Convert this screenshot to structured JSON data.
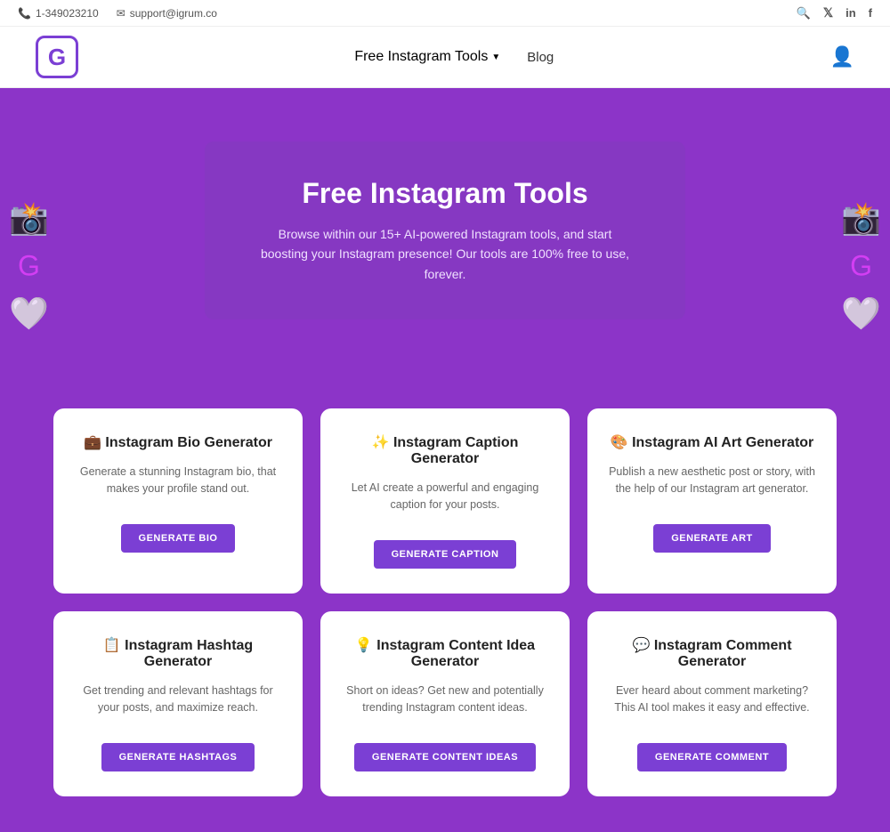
{
  "topbar": {
    "phone": "1-349023210",
    "email": "support@igrum.co"
  },
  "nav": {
    "logo_letter": "G",
    "tools_label": "Free Instagram Tools",
    "blog_label": "Blog"
  },
  "hero": {
    "title": "Free Instagram Tools",
    "description": "Browse within our 15+ AI-powered Instagram tools, and start boosting your Instagram presence! Our tools are 100% free to use, forever."
  },
  "cards": [
    {
      "emoji": "💼",
      "title": "Instagram Bio Generator",
      "description": "Generate a stunning Instagram bio, that makes your profile stand out.",
      "button": "GENERATE BIO"
    },
    {
      "emoji": "✨",
      "title": "Instagram Caption Generator",
      "description": "Let AI create a powerful and engaging caption for your posts.",
      "button": "GENERATE CAPTION"
    },
    {
      "emoji": "🎨",
      "title": "Instagram AI Art Generator",
      "description": "Publish a new aesthetic post or story, with the help of our Instagram art generator.",
      "button": "GENERATE ART"
    },
    {
      "emoji": "📋",
      "title": "Instagram Hashtag Generator",
      "description": "Get trending and relevant hashtags for your posts, and maximize reach.",
      "button": "GENERATE HASHTAGS"
    },
    {
      "emoji": "💡",
      "title": "Instagram Content Idea Generator",
      "description": "Short on ideas? Get new and potentially trending Instagram content ideas.",
      "button": "GENERATE CONTENT IDEAS"
    },
    {
      "emoji": "💬",
      "title": "Instagram Comment Generator",
      "description": "Ever heard about comment marketing? This AI tool makes it easy and effective.",
      "button": "GENERATE COMMENT"
    }
  ],
  "social": {
    "search": "🔍",
    "twitter": "𝕏",
    "linkedin": "in",
    "facebook": "f"
  }
}
